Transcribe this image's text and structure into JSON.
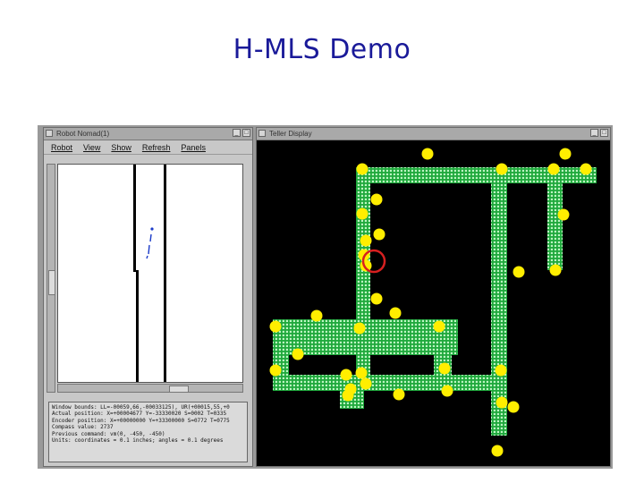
{
  "slide": {
    "title": "H-MLS Demo"
  },
  "left_window": {
    "title": "Robot Nomad(1)",
    "menu": [
      "Robot",
      "View",
      "Show",
      "Refresh",
      "Panels"
    ],
    "info_lines": [
      "Window bounds: LL=-00059,66,-00033125), UR(+00015,55,+0",
      "Actual position: X=+00004677 Y=-33330020 S=0002 T=0335",
      "Encoder position: X=+00000000 Y=+33300000 S=0772 T=0775",
      "Compass value: 2737",
      "Previous command: vm(0, -450, -450)",
      "Units: coordinates = 0.1 inches; angles = 0.1 degrees"
    ]
  },
  "right_window": {
    "title": "Teller Display"
  },
  "colors": {
    "corridor": "#1fa83c",
    "dot_grid": "#bdf5c2",
    "node": "#ffee00",
    "marker": "#d62020",
    "display_bg": "#000000",
    "title_text": "#1a1a99"
  }
}
